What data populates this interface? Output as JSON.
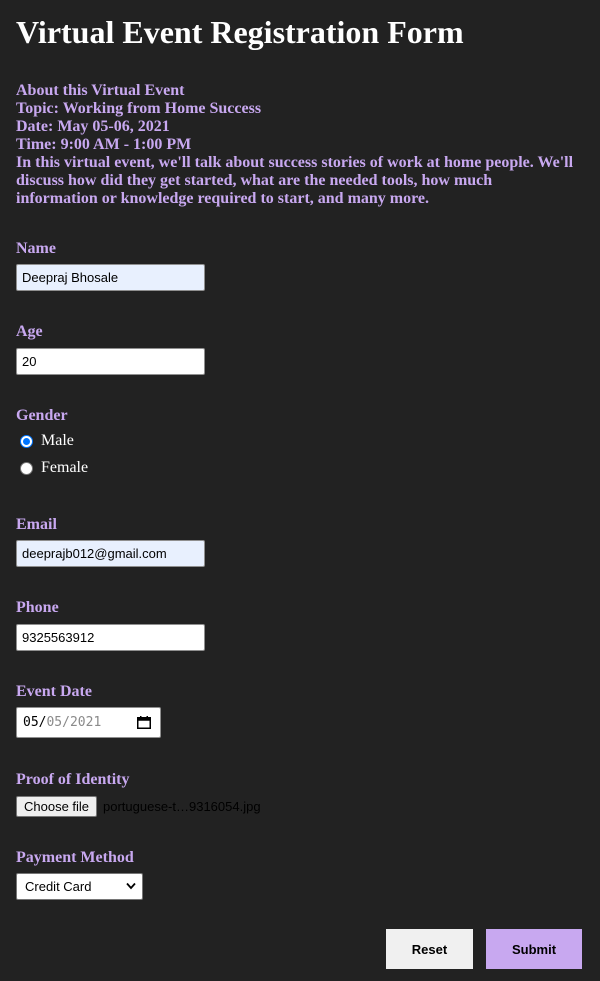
{
  "title": "Virtual Event Registration Form",
  "about": {
    "heading": "About this Virtual Event",
    "topic": "Topic: Working from Home Success",
    "date": "Date: May 05-06, 2021",
    "time": "Time: 9:00 AM - 1:00 PM",
    "description": "In this virtual event, we'll talk about success stories of work at home people. We'll discuss how did they get started, what are the needed tools, how much information or knowledge required to start, and many more."
  },
  "form": {
    "name": {
      "label": "Name",
      "value": "Deepraj Bhosale"
    },
    "age": {
      "label": "Age",
      "value": "20"
    },
    "gender": {
      "label": "Gender",
      "options": [
        {
          "label": "Male",
          "checked": true
        },
        {
          "label": "Female",
          "checked": false
        }
      ]
    },
    "email": {
      "label": "Email",
      "value": "deeprajb012@gmail.com"
    },
    "phone": {
      "label": "Phone",
      "value": "9325563912"
    },
    "event_date": {
      "label": "Event Date",
      "month": "05",
      "day": "05",
      "year": "2021",
      "separator": "/"
    },
    "proof": {
      "label": "Proof of Identity",
      "button_label": "Choose file",
      "file_name": "portuguese-t…9316054.jpg"
    },
    "payment": {
      "label": "Payment Method",
      "selected": "Credit Card"
    }
  },
  "buttons": {
    "reset_label": "Reset",
    "submit_label": "Submit"
  },
  "colors": {
    "background": "#222222",
    "accent": "#c8a8f0",
    "autofill": "#e8f0fe",
    "radio": "#0075ff"
  },
  "icons": {
    "date_picker": "calendar-icon",
    "select": "chevron-down-icon"
  }
}
